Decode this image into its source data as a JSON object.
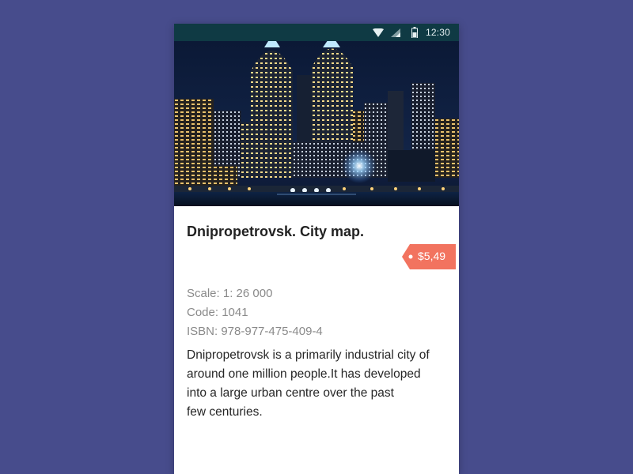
{
  "status_bar": {
    "time": "12:30",
    "icons": [
      "wifi-icon",
      "signal-icon",
      "battery-icon"
    ]
  },
  "hero_image": {
    "subject": "city-skyline-at-night"
  },
  "product": {
    "title": "Dnipropetrovsk. City map.",
    "price": "$5,49",
    "scale": "Scale: 1: 26 000",
    "code": "Code: 1041",
    "isbn": "ISBN: 978-977-475-409-4",
    "description_lines": [
      "Dnipropetrovsk is a primarily industrial city of",
      "around one million people.It has developed",
      "into a large urban centre over the past",
      "few centuries."
    ]
  },
  "colors": {
    "background": "#474c8c",
    "status_bar": "#0f3a44",
    "price_tag": "#f2735f"
  }
}
